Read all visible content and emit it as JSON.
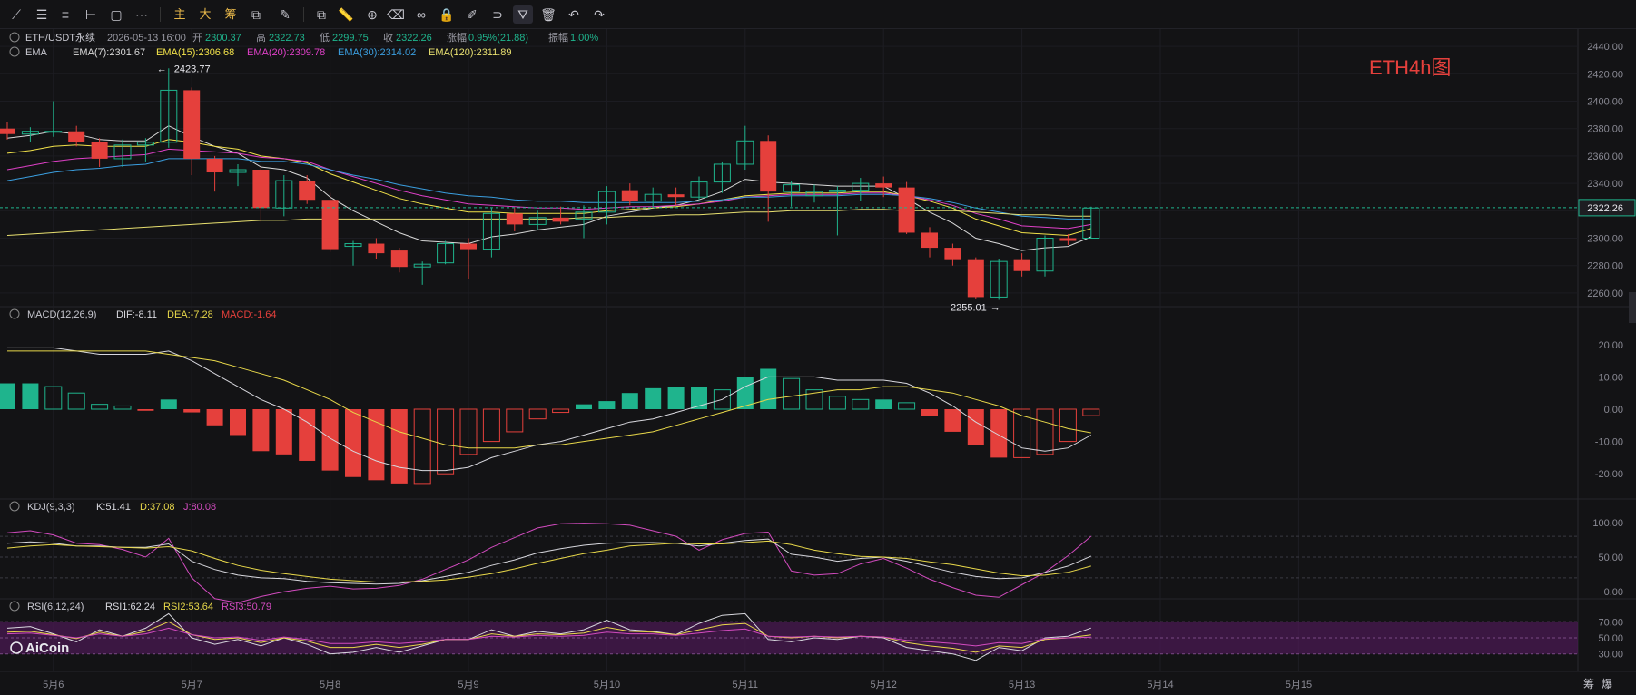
{
  "toolbar": {
    "items": [
      {
        "name": "trendline-icon",
        "glyph": "⟋"
      },
      {
        "name": "horizontal-lines-icon",
        "glyph": "☰"
      },
      {
        "name": "channel-icon",
        "glyph": "≡"
      },
      {
        "name": "ray-icon",
        "glyph": "⊢"
      },
      {
        "name": "rectangle-icon",
        "glyph": "▢"
      },
      {
        "name": "path-icon",
        "glyph": "⋯"
      },
      {
        "name": "main-chart-button",
        "glyph": "主"
      },
      {
        "name": "large-order-button",
        "glyph": "大"
      },
      {
        "name": "chip-button",
        "glyph": "筹"
      },
      {
        "name": "layout-icon",
        "glyph": "⧉"
      },
      {
        "name": "brush-icon",
        "glyph": "✎"
      },
      {
        "name": "copy-icon",
        "glyph": "⧉"
      },
      {
        "name": "ruler-icon",
        "glyph": "📏"
      },
      {
        "name": "zoom-icon",
        "glyph": "⊕"
      },
      {
        "name": "eraser-icon",
        "glyph": "⌫"
      },
      {
        "name": "pattern-icon",
        "glyph": "∞"
      },
      {
        "name": "lock-icon",
        "glyph": "🔒"
      },
      {
        "name": "edit-icon",
        "glyph": "✐"
      },
      {
        "name": "magnet-icon",
        "glyph": "⊃"
      },
      {
        "name": "filter-icon",
        "glyph": "⛛"
      },
      {
        "name": "delete-icon",
        "glyph": "🗑"
      },
      {
        "name": "undo-icon",
        "glyph": "↶"
      },
      {
        "name": "redo-icon",
        "glyph": "↷"
      }
    ]
  },
  "chart_data": {
    "type": "candlestick",
    "symbol": "ETH/USDT永续",
    "info": {
      "time": "2026-05-13 16:00",
      "open_label": "开",
      "open": "2300.37",
      "high_label": "高",
      "high": "2322.73",
      "low_label": "低",
      "low": "2299.75",
      "close_label": "收",
      "close": "2322.26",
      "change_label": "涨幅",
      "change": "0.95%(21.88)",
      "amplitude_label": "振幅",
      "amplitude": "1.00%"
    },
    "annotation": "ETH4h图",
    "price_tag": "2322.26",
    "high_marker": "2423.77",
    "low_marker": "2255.01",
    "x_ticks": [
      {
        "label": "5月6",
        "i": 2
      },
      {
        "label": "5月7",
        "i": 8
      },
      {
        "label": "5月8",
        "i": 14
      },
      {
        "label": "5月9",
        "i": 20
      },
      {
        "label": "5月10",
        "i": 26
      },
      {
        "label": "5月11",
        "i": 32
      },
      {
        "label": "5月12",
        "i": 38
      },
      {
        "label": "5月13",
        "i": 44
      },
      {
        "label": "5月14",
        "i": 50
      },
      {
        "label": "5月15",
        "i": 56
      }
    ],
    "price_axis": {
      "min": 2250,
      "max": 2450,
      "ticks": [
        "2440.00",
        "2420.00",
        "2400.00",
        "2380.00",
        "2360.00",
        "2340.00",
        "2320.00",
        "2300.00",
        "2280.00",
        "2260.00"
      ]
    },
    "candles": [
      [
        2380,
        2385,
        2372,
        2376
      ],
      [
        2376,
        2381,
        2370,
        2378
      ],
      [
        2378,
        2400,
        2374,
        2378
      ],
      [
        2378,
        2382,
        2367,
        2370
      ],
      [
        2370,
        2373,
        2352,
        2358
      ],
      [
        2358,
        2372,
        2352,
        2368
      ],
      [
        2368,
        2373,
        2356,
        2370
      ],
      [
        2370,
        2424,
        2366,
        2408
      ],
      [
        2408,
        2410,
        2346,
        2358
      ],
      [
        2358,
        2360,
        2334,
        2348
      ],
      [
        2348,
        2354,
        2338,
        2350
      ],
      [
        2350,
        2353,
        2312,
        2322
      ],
      [
        2322,
        2346,
        2316,
        2342
      ],
      [
        2342,
        2346,
        2325,
        2328
      ],
      [
        2328,
        2333,
        2290,
        2292
      ],
      [
        2294,
        2298,
        2280,
        2296
      ],
      [
        2296,
        2300,
        2285,
        2289
      ],
      [
        2291,
        2293,
        2275,
        2279
      ],
      [
        2279,
        2283,
        2266,
        2281
      ],
      [
        2282,
        2298,
        2281,
        2296
      ],
      [
        2296,
        2300,
        2270,
        2292
      ],
      [
        2292,
        2322,
        2286,
        2318
      ],
      [
        2318,
        2322,
        2305,
        2310
      ],
      [
        2310,
        2320,
        2306,
        2315
      ],
      [
        2315,
        2323,
        2310,
        2312
      ],
      [
        2314,
        2324,
        2300,
        2319
      ],
      [
        2319,
        2338,
        2310,
        2334
      ],
      [
        2335,
        2340,
        2324,
        2327
      ],
      [
        2327,
        2337,
        2322,
        2332
      ],
      [
        2332,
        2337,
        2324,
        2330
      ],
      [
        2330,
        2345,
        2328,
        2341
      ],
      [
        2341,
        2356,
        2333,
        2354
      ],
      [
        2354,
        2382,
        2350,
        2371
      ],
      [
        2371,
        2375,
        2312,
        2334
      ],
      [
        2334,
        2342,
        2323,
        2339
      ],
      [
        2331,
        2339,
        2326,
        2334
      ],
      [
        2334,
        2338,
        2302,
        2335
      ],
      [
        2335,
        2344,
        2327,
        2340
      ],
      [
        2340,
        2345,
        2330,
        2337
      ],
      [
        2337,
        2341,
        2303,
        2304
      ],
      [
        2304,
        2308,
        2286,
        2293
      ],
      [
        2293,
        2296,
        2280,
        2284
      ],
      [
        2284,
        2286,
        2256,
        2257
      ],
      [
        2257,
        2285,
        2255,
        2283
      ],
      [
        2284,
        2289,
        2272,
        2276
      ],
      [
        2276,
        2302,
        2272,
        2300
      ],
      [
        2300,
        2303,
        2295,
        2298
      ],
      [
        2300,
        2323,
        2300,
        2322
      ]
    ],
    "ema": {
      "legend_label": "EMA",
      "series": [
        {
          "name": "EMA(7)",
          "value": "2301.67",
          "color": "#d9d9d9",
          "values": [
            2373,
            2375,
            2378,
            2376,
            2372,
            2371,
            2371,
            2382,
            2374,
            2367,
            2362,
            2352,
            2350,
            2344,
            2330,
            2320,
            2312,
            2304,
            2298,
            2297,
            2296,
            2301,
            2303,
            2306,
            2308,
            2310,
            2316,
            2319,
            2322,
            2324,
            2328,
            2334,
            2343,
            2341,
            2340,
            2339,
            2338,
            2338,
            2338,
            2329,
            2319,
            2311,
            2300,
            2296,
            2291,
            2293,
            2294,
            2301
          ]
        },
        {
          "name": "EMA(15)",
          "value": "2306.68",
          "color": "#f2e24a",
          "values": [
            2362,
            2364,
            2367,
            2368,
            2367,
            2367,
            2367,
            2372,
            2370,
            2367,
            2365,
            2360,
            2358,
            2355,
            2347,
            2341,
            2335,
            2329,
            2325,
            2322,
            2319,
            2319,
            2318,
            2318,
            2318,
            2318,
            2320,
            2321,
            2322,
            2323,
            2325,
            2328,
            2331,
            2332,
            2333,
            2333,
            2333,
            2334,
            2334,
            2331,
            2327,
            2322,
            2314,
            2309,
            2304,
            2303,
            2302,
            2307
          ]
        },
        {
          "name": "EMA(20)",
          "value": "2309.78",
          "color": "#e040c8",
          "values": [
            2350,
            2353,
            2356,
            2358,
            2359,
            2360,
            2361,
            2365,
            2364,
            2363,
            2362,
            2359,
            2358,
            2356,
            2350,
            2345,
            2340,
            2335,
            2331,
            2328,
            2325,
            2324,
            2323,
            2322,
            2322,
            2321,
            2322,
            2323,
            2323,
            2324,
            2325,
            2327,
            2330,
            2331,
            2332,
            2332,
            2332,
            2333,
            2333,
            2331,
            2328,
            2324,
            2318,
            2314,
            2309,
            2308,
            2307,
            2310
          ]
        },
        {
          "name": "EMA(30)",
          "value": "2314.02",
          "color": "#3b9fe0",
          "values": [
            2342,
            2345,
            2348,
            2350,
            2351,
            2353,
            2354,
            2358,
            2358,
            2358,
            2358,
            2356,
            2356,
            2354,
            2350,
            2346,
            2343,
            2339,
            2336,
            2333,
            2331,
            2330,
            2328,
            2327,
            2327,
            2326,
            2326,
            2326,
            2326,
            2326,
            2327,
            2328,
            2330,
            2330,
            2331,
            2331,
            2331,
            2332,
            2332,
            2331,
            2329,
            2326,
            2322,
            2319,
            2316,
            2315,
            2314,
            2314
          ]
        },
        {
          "name": "EMA(120)",
          "value": "2311.89",
          "color": "#e8e070",
          "values": [
            2302,
            2303,
            2304,
            2305,
            2306,
            2307,
            2308,
            2309,
            2310,
            2311,
            2312,
            2313,
            2313,
            2314,
            2314,
            2314,
            2314,
            2314,
            2314,
            2314,
            2314,
            2314,
            2314,
            2314,
            2314,
            2315,
            2315,
            2316,
            2316,
            2317,
            2317,
            2318,
            2319,
            2319,
            2320,
            2320,
            2320,
            2321,
            2321,
            2320,
            2320,
            2320,
            2319,
            2318,
            2317,
            2317,
            2316,
            2316
          ]
        }
      ]
    },
    "macd": {
      "label": "MACD(12,26,9)",
      "dif_label": "DIF:-8.11",
      "dea_label": "DEA:-7.28",
      "macd_label": "MACD:-1.64",
      "axis": {
        "min": -25,
        "max": 25,
        "ticks": [
          "20.00",
          "10.00",
          "0.00",
          "-10.00",
          "-20.00"
        ]
      },
      "hist": [
        8,
        8,
        7,
        5,
        1.5,
        1,
        -0.5,
        3,
        -1,
        -5,
        -8,
        -13,
        -14,
        -16,
        -19,
        -21,
        -22,
        -23,
        -23,
        -20,
        -14,
        -10,
        -7,
        -3,
        -1,
        1.5,
        2.5,
        5,
        6.5,
        7,
        7,
        6,
        10,
        12.5,
        9.5,
        6,
        4,
        3,
        3,
        2,
        -2,
        -7,
        -11,
        -15,
        -15,
        -14,
        -10,
        -2
      ],
      "dif": [
        19,
        19,
        19,
        18,
        17,
        17,
        17,
        18,
        15,
        11,
        7,
        3,
        0,
        -4,
        -9,
        -13,
        -16,
        -18,
        -19,
        -19,
        -18,
        -15,
        -13,
        -11,
        -10,
        -8,
        -6,
        -4,
        -3,
        -1,
        1,
        3,
        7,
        10,
        10,
        10,
        9,
        9,
        9,
        8,
        5,
        1,
        -4,
        -8,
        -12,
        -13,
        -12,
        -8
      ],
      "dea": [
        18,
        18,
        18,
        18,
        18,
        18,
        18,
        17,
        16,
        15,
        13,
        11,
        9,
        6,
        3,
        -1,
        -4,
        -7,
        -9,
        -11,
        -12,
        -12,
        -12,
        -11,
        -11,
        -10,
        -9,
        -8,
        -7,
        -5,
        -3,
        -1,
        1,
        3,
        4,
        5,
        6,
        6,
        7,
        7,
        6,
        5,
        3,
        1,
        -2,
        -4,
        -6,
        -7.3
      ]
    },
    "kdj": {
      "label": "KDJ(9,3,3)",
      "k_label": "K:51.41",
      "d_label": "D:37.08",
      "j_label": "J:80.08",
      "axis": {
        "min": -5,
        "max": 105,
        "ticks": [
          "100.00",
          "50.00",
          "0.00"
        ]
      },
      "k": [
        70,
        72,
        70,
        66,
        66,
        64,
        64,
        69,
        44,
        32,
        24,
        20,
        19,
        15,
        13,
        12,
        11,
        12,
        16,
        22,
        28,
        38,
        46,
        56,
        62,
        67,
        70,
        71,
        71,
        70,
        66,
        70,
        74,
        76,
        54,
        50,
        44,
        48,
        50,
        44,
        36,
        28,
        22,
        19,
        20,
        28,
        37,
        51.41
      ],
      "d": [
        63,
        66,
        68,
        66,
        65,
        64,
        63,
        65,
        59,
        48,
        38,
        31,
        26,
        22,
        18,
        16,
        14,
        14,
        15,
        17,
        21,
        26,
        33,
        41,
        48,
        55,
        60,
        66,
        68,
        70,
        69,
        69,
        71,
        73,
        68,
        60,
        55,
        51,
        50,
        48,
        43,
        39,
        33,
        27,
        23,
        24,
        28,
        37.08
      ],
      "j": [
        85,
        88,
        82,
        70,
        68,
        61,
        50,
        77,
        20,
        -10,
        -16,
        -7,
        0,
        5,
        8,
        4,
        5,
        9,
        18,
        32,
        46,
        64,
        78,
        92,
        98,
        99,
        98,
        96,
        88,
        80,
        60,
        75,
        84,
        86,
        30,
        24,
        26,
        40,
        48,
        34,
        18,
        6,
        -5,
        -8,
        10,
        28,
        52,
        80.08
      ]
    },
    "rsi": {
      "label": "RSI(6,12,24)",
      "rsi1_label": "RSI1:62.24",
      "rsi2_label": "RSI2:53.64",
      "rsi3_label": "RSI3:50.79",
      "axis": {
        "min": 15,
        "max": 85,
        "ticks": [
          "70.00",
          "50.00",
          "30.00"
        ]
      },
      "rsi1": [
        62,
        64,
        55,
        45,
        60,
        52,
        62,
        80,
        50,
        42,
        48,
        40,
        50,
        42,
        30,
        32,
        38,
        32,
        40,
        48,
        48,
        60,
        52,
        58,
        55,
        60,
        72,
        60,
        58,
        54,
        68,
        78,
        80,
        48,
        45,
        50,
        48,
        52,
        50,
        38,
        34,
        30,
        22,
        38,
        34,
        50,
        52,
        62.24
      ],
      "rsi2": [
        57,
        58,
        54,
        49,
        57,
        52,
        58,
        70,
        54,
        48,
        50,
        44,
        50,
        46,
        38,
        38,
        42,
        38,
        42,
        48,
        48,
        55,
        52,
        55,
        54,
        56,
        63,
        58,
        57,
        54,
        60,
        66,
        68,
        52,
        50,
        52,
        50,
        52,
        51,
        44,
        40,
        37,
        32,
        40,
        38,
        48,
        50,
        53.64
      ],
      "rsi3": [
        55,
        56,
        53,
        50,
        55,
        52,
        55,
        62,
        54,
        50,
        51,
        47,
        51,
        48,
        43,
        43,
        45,
        43,
        45,
        48,
        48,
        52,
        51,
        53,
        52,
        53,
        57,
        55,
        55,
        53,
        56,
        59,
        61,
        52,
        51,
        52,
        51,
        52,
        51,
        47,
        45,
        43,
        40,
        44,
        43,
        49,
        50,
        50.79
      ]
    }
  },
  "brand": {
    "name": "AiCoin"
  },
  "corner": {
    "label1": "筹",
    "label2": "爆"
  },
  "colors": {
    "up": "#1fb48d",
    "down": "#e5403c",
    "bg": "#131315",
    "grid": "#2a2a30"
  }
}
